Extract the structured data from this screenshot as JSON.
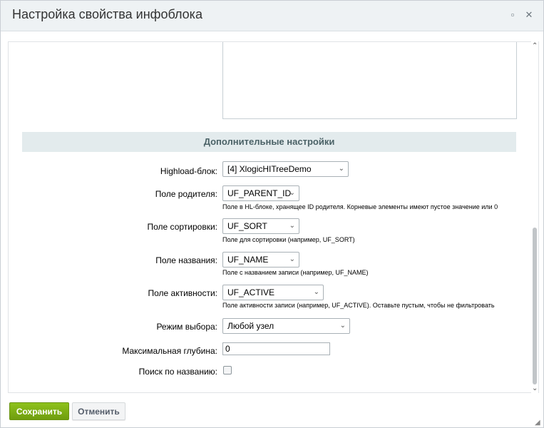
{
  "dialog": {
    "title": "Настройка свойства инфоблока"
  },
  "section": {
    "title": "Дополнительные настройки"
  },
  "fields": {
    "highload": {
      "label": "Highload-блок:",
      "value": "[4] XlogicHITreeDemo"
    },
    "parent": {
      "label": "Поле родителя:",
      "value": "UF_PARENT_ID",
      "hint": "Поле в HL-блоке, хранящее ID родителя. Корневые элементы имеют пустое значение или 0"
    },
    "sort": {
      "label": "Поле сортировки:",
      "value": "UF_SORT",
      "hint": "Поле для сортировки (например, UF_SORT)"
    },
    "name": {
      "label": "Поле названия:",
      "value": "UF_NAME",
      "hint": "Поле с названием записи (например, UF_NAME)"
    },
    "active": {
      "label": "Поле активности:",
      "value": "UF_ACTIVE",
      "hint": "Поле активности записи (например, UF_ACTIVE). Оставьте пустым, чтобы не фильтровать"
    },
    "mode": {
      "label": "Режим выбора:",
      "value": "Любой узел"
    },
    "depth": {
      "label": "Максимальная глубина:",
      "value": "0"
    },
    "search": {
      "label": "Поиск по названию:",
      "checked": false
    }
  },
  "buttons": {
    "save": "Сохранить",
    "cancel": "Отменить"
  },
  "icons": {
    "maximize": "maximize-icon",
    "close": "close-icon"
  },
  "colors": {
    "save": "#7cb316",
    "section_bg": "#e3ebed",
    "titlebar_bg": "#eef2f4"
  }
}
